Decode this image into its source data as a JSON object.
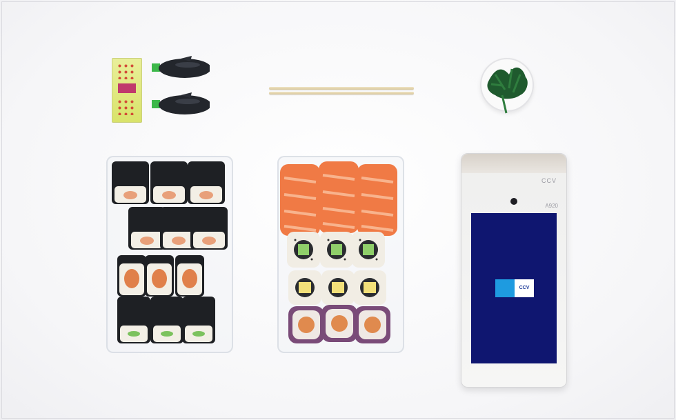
{
  "scene": {
    "sachet_text": "",
    "terminal": {
      "brand": "CCV",
      "model": "A920",
      "screen_logo_left": "",
      "screen_logo_right": "CCV"
    }
  },
  "colors": {
    "background": "#f7f7f8",
    "nori": "#1e2024",
    "rice": "#f3efe6",
    "salmon": "#f07a45",
    "terminal_screen": "#0f1670",
    "logo_blue": "#1e9be0"
  }
}
